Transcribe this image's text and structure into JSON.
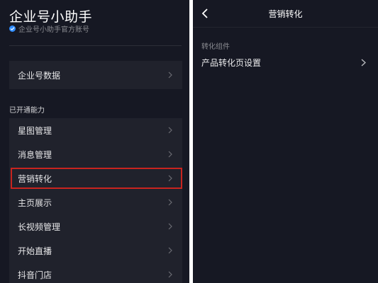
{
  "left": {
    "title": "企业号小助手",
    "subtitle": "企业号小助手官方账号",
    "data_item": "企业号数据",
    "section_label": "已开通能力",
    "abilities": [
      "星图管理",
      "消息管理",
      "营销转化",
      "主页展示",
      "长视频管理",
      "开始直播",
      "抖音门店"
    ],
    "highlight_color": "#c8241f"
  },
  "right": {
    "nav_title": "营销转化",
    "group_label": "转化组件",
    "setting_item": "产品转化页设置"
  },
  "icons": {
    "verified": "verified-badge-icon",
    "chevron": "chevron-right-icon",
    "back": "back-arrow-icon"
  }
}
